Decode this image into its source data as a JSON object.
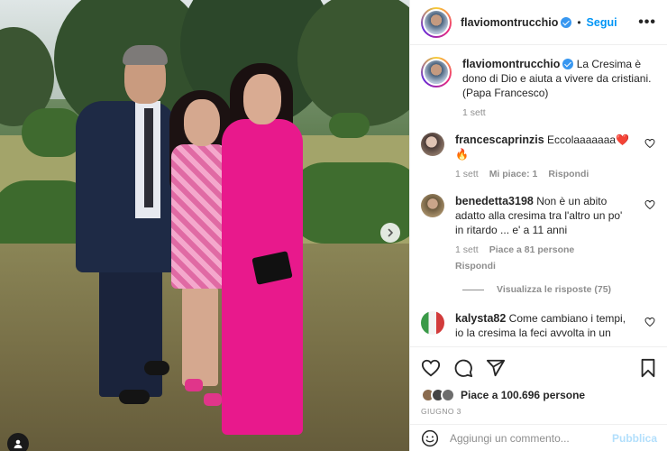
{
  "post": {
    "username": "flaviomontrucchio",
    "follow_label": "Segui",
    "dot": "•",
    "more_label": "•••",
    "caption": "La Cresima è dono di Dio e aiuta a vivere da cristiani. (Papa Francesco)",
    "caption_time": "1 sett",
    "likes_text": "Piace a 100.696 persone",
    "date": "GIUGNO 3"
  },
  "comments": [
    {
      "username": "francescaprinzis",
      "text": "Eccolaaaaaaa❤️🔥",
      "time": "1 sett",
      "likes": "Mi piace: 1",
      "reply": "Rispondi"
    },
    {
      "username": "benedetta3198",
      "text": "Non è un abito adatto alla cresima tra l'altro un po' in ritardo ... e' a 11 anni",
      "time": "1 sett",
      "likes": "Piace a 81 persone",
      "reply": "Rispondi",
      "view_replies": "Visualizza le risposte (75)"
    },
    {
      "username": "kalysta82",
      "text": "Come cambiano i tempi, io la cresima la feci avvolta in un"
    }
  ],
  "comment_box": {
    "placeholder": "Aggiungi un commento...",
    "publish_label": "Pubblica"
  },
  "colors": {
    "accent": "#0095f6",
    "suit_pink": "#e8198c",
    "verified": "#3897f0"
  },
  "icons": [
    "heart-icon",
    "comment-icon",
    "share-icon",
    "bookmark-icon",
    "emoji-icon",
    "chevron-right-icon",
    "user-tag-icon",
    "verified-icon",
    "more-icon"
  ]
}
